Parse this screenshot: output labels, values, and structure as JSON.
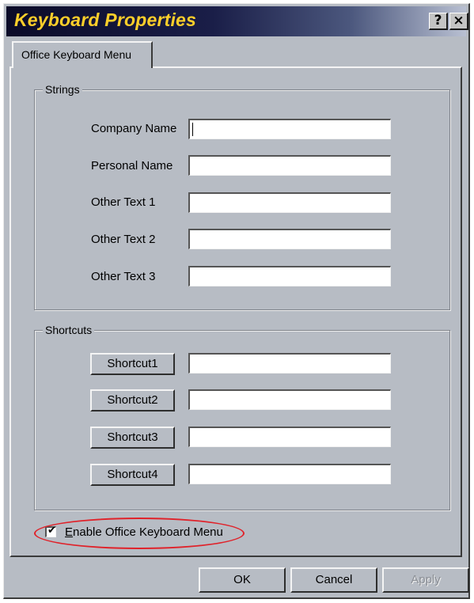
{
  "window": {
    "title": "Keyboard Properties",
    "help_button": "?",
    "close_button": "×"
  },
  "tabs": [
    {
      "label": "Office Keyboard Menu",
      "active": true
    }
  ],
  "strings_group": {
    "label": "Strings",
    "fields": [
      {
        "label": "Company Name",
        "value": ""
      },
      {
        "label": "Personal Name",
        "value": ""
      },
      {
        "label": "Other Text 1",
        "value": ""
      },
      {
        "label": "Other Text 2",
        "value": ""
      },
      {
        "label": "Other Text 3",
        "value": ""
      }
    ]
  },
  "shortcuts_group": {
    "label": "Shortcuts",
    "items": [
      {
        "button": "Shortcut1",
        "value": ""
      },
      {
        "button": "Shortcut2",
        "value": ""
      },
      {
        "button": "Shortcut3",
        "value": ""
      },
      {
        "button": "Shortcut4",
        "value": ""
      }
    ]
  },
  "enable_checkbox": {
    "accel": "E",
    "label_rest": "nable Office Keyboard Menu",
    "checked": true,
    "mark": "✔"
  },
  "buttons": {
    "ok": "OK",
    "cancel": "Cancel",
    "apply": "Apply"
  },
  "colors": {
    "dialog_bg": "#b7bcc4",
    "title_text": "#ffcf2a",
    "highlight": "#e0222a"
  }
}
